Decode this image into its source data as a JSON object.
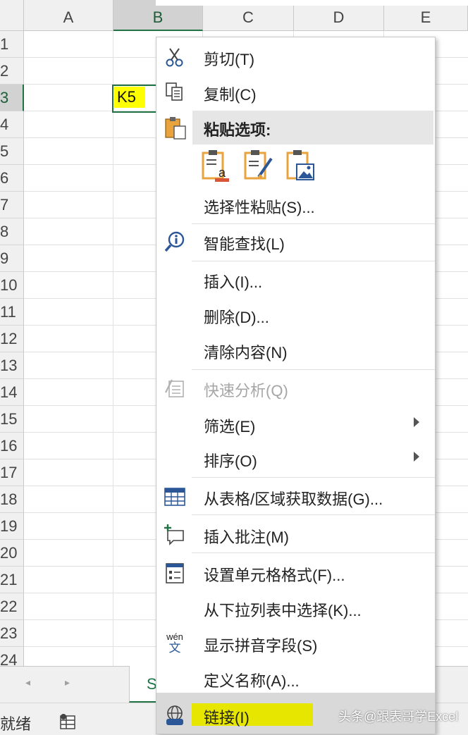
{
  "sheet": {
    "columns": [
      "A",
      "B",
      "C",
      "D",
      "E"
    ],
    "selected_column": "B",
    "rows": [
      "1",
      "2",
      "3",
      "4",
      "5",
      "6",
      "7",
      "8",
      "9",
      "10",
      "11",
      "12",
      "13",
      "14",
      "15",
      "16",
      "17",
      "18",
      "19",
      "20",
      "21",
      "22",
      "23",
      "24"
    ],
    "selected_row": "3",
    "active_cell_value": "K5",
    "highlight_color": "#ffff00",
    "accent_color": "#217346"
  },
  "tabs": {
    "prev_icon": "◂",
    "next_icon": "▸",
    "sheet_tab_label": "S"
  },
  "status": {
    "text": "就绪",
    "icon": "accessibility-icon"
  },
  "menu": {
    "cut": "剪切(T)",
    "copy": "复制(C)",
    "paste_options_header": "粘贴选项:",
    "paste_special": "选择性粘贴(S)...",
    "smart_lookup": "智能查找(L)",
    "insert": "插入(I)...",
    "delete": "删除(D)...",
    "clear_contents": "清除内容(N)",
    "quick_analysis": "快速分析(Q)",
    "filter": "筛选(E)",
    "sort": "排序(O)",
    "get_data_from_table": "从表格/区域获取数据(G)...",
    "insert_comment": "插入批注(M)",
    "format_cells": "设置单元格格式(F)...",
    "pick_from_dropdown": "从下拉列表中选择(K)...",
    "show_phonetic": "显示拼音字段(S)",
    "define_name": "定义名称(A)...",
    "link": "链接(I)",
    "phonetic_icon_top": "wén",
    "phonetic_icon_bottom": "文"
  },
  "watermark": {
    "text": "头条@跟表哥学Excel"
  }
}
